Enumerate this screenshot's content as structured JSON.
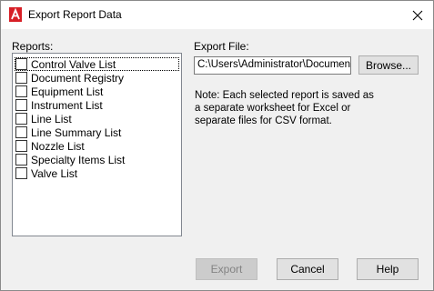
{
  "window": {
    "title": "Export Report Data",
    "close_glyph": "✕"
  },
  "reports": {
    "label": "Reports:",
    "items": [
      {
        "label": "Control Valve List",
        "checked": false
      },
      {
        "label": "Document Registry",
        "checked": false
      },
      {
        "label": "Equipment List",
        "checked": false
      },
      {
        "label": "Instrument List",
        "checked": false
      },
      {
        "label": "Line List",
        "checked": false
      },
      {
        "label": "Line Summary List",
        "checked": false
      },
      {
        "label": "Nozzle List",
        "checked": false
      },
      {
        "label": "Specialty Items List",
        "checked": false
      },
      {
        "label": "Valve List",
        "checked": false
      }
    ]
  },
  "export_file": {
    "label": "Export File:",
    "value": "C:\\Users\\Administrator\\Documents\\",
    "browse_label": "Browse..."
  },
  "note": "Note: Each selected report is saved as a separate worksheet for Excel or separate files for CSV format.",
  "buttons": {
    "export": "Export",
    "cancel": "Cancel",
    "help": "Help"
  },
  "colors": {
    "app_icon": "#d71f26"
  }
}
